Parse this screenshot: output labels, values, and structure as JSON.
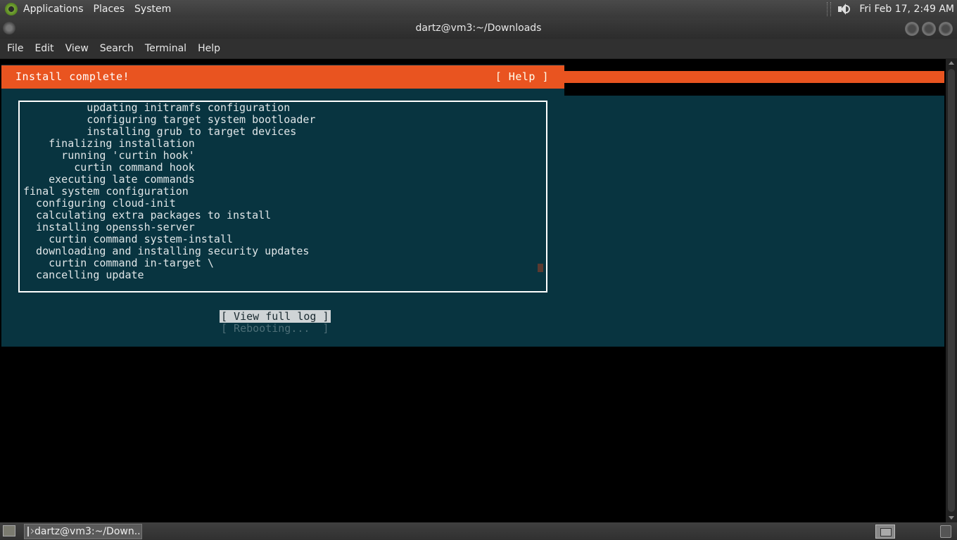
{
  "top_panel": {
    "menus": [
      "Applications",
      "Places",
      "System"
    ],
    "clock": "Fri Feb 17,  2:49 AM"
  },
  "window": {
    "title": "dartz@vm3:~/Downloads"
  },
  "menubar": {
    "items": [
      "File",
      "Edit",
      "View",
      "Search",
      "Terminal",
      "Help"
    ]
  },
  "installer": {
    "header": "Install complete!",
    "help": "[ Help ]",
    "log_lines": [
      "          updating initramfs configuration",
      "          configuring target system bootloader",
      "          installing grub to target devices",
      "    finalizing installation",
      "      running 'curtin hook'",
      "        curtin command hook",
      "    executing late commands",
      "final system configuration",
      "  configuring cloud-init",
      "  calculating extra packages to install",
      "  installing openssh-server",
      "    curtin command system-install",
      "  downloading and installing security updates",
      "    curtin command in-target \\",
      "  cancelling update"
    ],
    "view_log_button": "[ View full log ]",
    "reboot_button": "[ Rebooting...  ]"
  },
  "bottom_panel": {
    "task_label": "dartz@vm3:~/Down..."
  },
  "colors": {
    "accent": "#e95420",
    "terminal_bg": "#083440"
  }
}
